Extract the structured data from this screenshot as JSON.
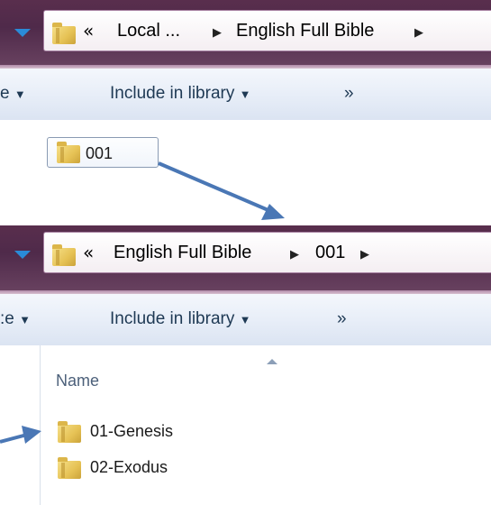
{
  "top_window": {
    "breadcrumb": {
      "overflow": "«",
      "items": [
        "Local ...",
        "English Full Bible"
      ]
    },
    "toolbar": {
      "left_partial": "e",
      "include_in_library": "Include in library",
      "more": "»"
    },
    "selected_folder": "001"
  },
  "bottom_window": {
    "breadcrumb": {
      "overflow": "«",
      "items": [
        "English Full Bible",
        "001"
      ]
    },
    "toolbar": {
      "left_partial": ":e",
      "include_in_library": "Include in library",
      "more": "»"
    },
    "column_header": "Name",
    "folders": [
      "01-Genesis",
      "02-Exodus"
    ]
  },
  "colors": {
    "arrow": "#4a77b5",
    "address_bar": "#4f2a4a",
    "toolbar": "#e8eef8"
  }
}
